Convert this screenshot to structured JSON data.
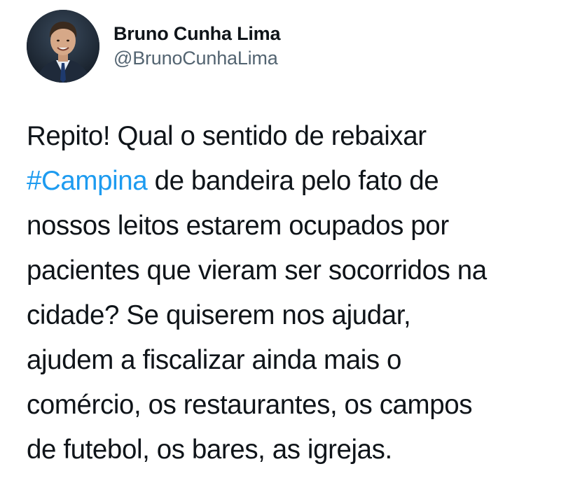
{
  "tweet": {
    "author": {
      "display_name": "Bruno Cunha Lima",
      "handle": "@BrunoCunhaLima",
      "avatar_icon": "profile-photo"
    },
    "text": {
      "line1": "Repito! Qual o sentido de rebaixar",
      "hashtag": "#Campina",
      "line2_rest": " de bandeira pelo fato de",
      "line3": "nossos leitos estarem ocupados por",
      "line4": "pacientes que vieram ser socorridos na",
      "line5": "cidade? Se quiserem nos ajudar,",
      "line6": "ajudem a fiscalizar ainda mais o",
      "line7": "comércio, os restaurantes, os campos",
      "line8": "de futebol, os bares, as igrejas."
    },
    "colors": {
      "text": "#0f1419",
      "handle": "#536471",
      "hashtag": "#1d9bf0",
      "background": "#ffffff"
    }
  }
}
